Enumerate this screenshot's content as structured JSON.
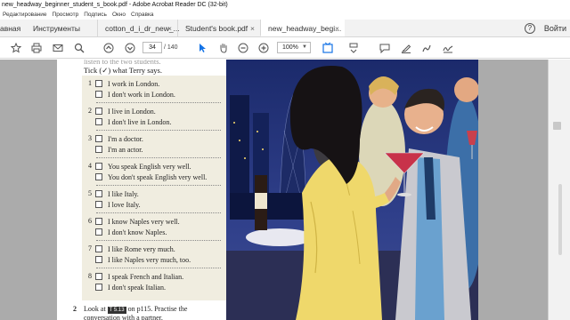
{
  "window": {
    "title": "new_headway_beginner_student_s_book.pdf - Adobe Acrobat Reader DC (32-bit)"
  },
  "menu": {
    "items": [
      "Редактирование",
      "Просмотр",
      "Подпись",
      "Окно",
      "Справка"
    ]
  },
  "tabs": {
    "home": "авная",
    "tools": "Инструменты",
    "docs": [
      {
        "label": "cotton_d_i_dr_new_...",
        "active": false
      },
      {
        "label": "Student's book.pdf",
        "active": false
      },
      {
        "label": "new_headway_begi...",
        "active": true
      }
    ],
    "help": "?",
    "login": "Войти"
  },
  "toolbar": {
    "page_current": "34",
    "page_total": "/ 140",
    "zoom": "100%",
    "icons": [
      "star-icon",
      "print-icon",
      "mail-icon",
      "search-icon",
      "page-up-icon",
      "page-down-icon",
      "select-cursor-icon",
      "hand-icon",
      "zoom-out-icon",
      "zoom-in-icon",
      "fit-page-icon",
      "scroll-mode-icon",
      "comment-icon",
      "highlight-icon",
      "draw-icon",
      "sign-icon"
    ]
  },
  "document": {
    "header": {
      "faded_text": "listen to the two students.",
      "instruction": "Tick (✓) what Terry says."
    },
    "items": [
      {
        "num": "1",
        "a": "I work in London.",
        "b": "I don't work in London."
      },
      {
        "num": "2",
        "a": "I live in London.",
        "b": "I don't live in London."
      },
      {
        "num": "3",
        "a": "I'm a doctor.",
        "b": "I'm an actor."
      },
      {
        "num": "4",
        "a": "You speak English very well.",
        "b": "You don't speak English very well."
      },
      {
        "num": "5",
        "a": "I like Italy.",
        "b": "I love Italy."
      },
      {
        "num": "6",
        "a": "I know Naples very well.",
        "b": "I don't know Naples."
      },
      {
        "num": "7",
        "a": "I like Rome very much.",
        "b": "I like Naples very much, too."
      },
      {
        "num": "8",
        "a": "I speak French and Italian.",
        "b": "I don't speak Italian."
      }
    ],
    "bottom": {
      "num": "2",
      "text_before": "Look at",
      "badge": "T 5.13",
      "text_after": "on p115. Practise the",
      "line2": "conversation with a partner."
    }
  },
  "colors": {
    "exercise_bg": "#f0ede0",
    "viewer_bg": "#ababab",
    "accent_blue": "#1473e6"
  }
}
